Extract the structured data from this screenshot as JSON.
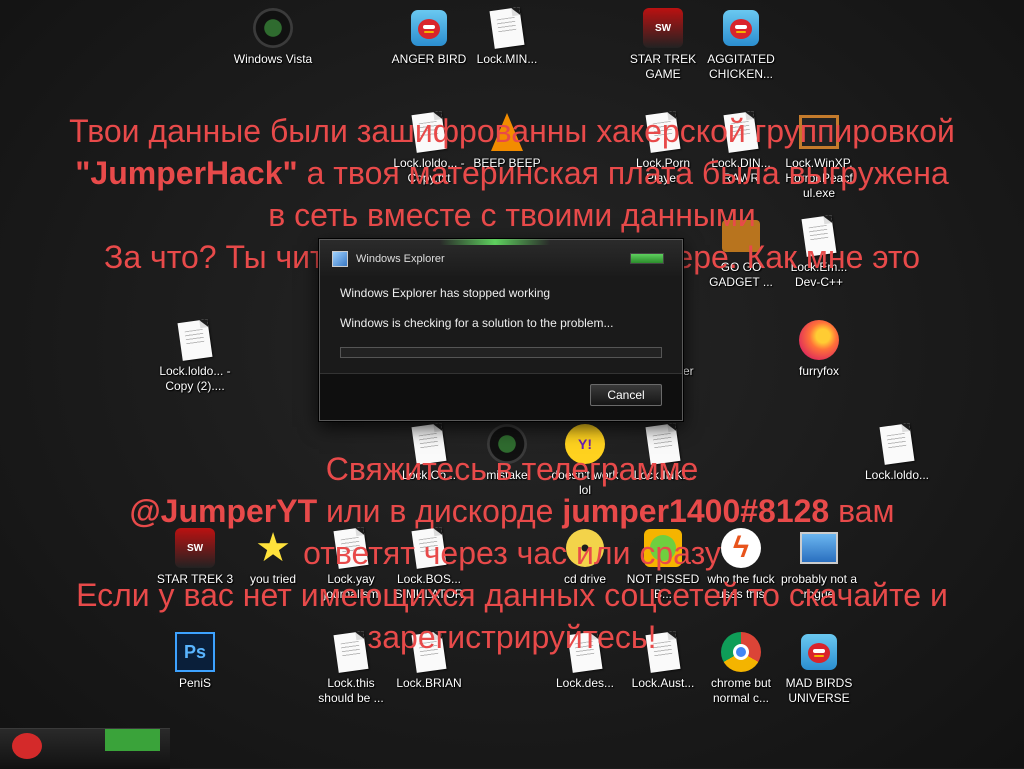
{
  "desktop": {
    "icons": [
      {
        "label": "Windows Vista",
        "icon": "round-green-icon"
      },
      {
        "label": "ANGER BIRD",
        "icon": "angry-bird-icon"
      },
      {
        "label": "Lock.MIN...",
        "icon": "document-icon"
      },
      {
        "label": "STAR TREK GAME",
        "icon": "star-wars-game-icon"
      },
      {
        "label": "AGGITATED CHICKEN...",
        "icon": "angry-bird-rio-icon"
      },
      {
        "label": "Lock.loldo... - Copy.txt",
        "icon": "document-icon"
      },
      {
        "label": "BEEP BEEP",
        "icon": "vlc-cone-icon"
      },
      {
        "label": "Lock.Porn Player",
        "icon": "document-icon"
      },
      {
        "label": "Lock.DIN... RAWR",
        "icon": "document-icon"
      },
      {
        "label": "Lock.WinXP. Horror.Peacf ul.exe",
        "icon": "tv-icon"
      },
      {
        "label": "GO GO GADGET ...",
        "icon": "briefcase-icon"
      },
      {
        "label": "Lock.Em... Dev-C++",
        "icon": "document-icon"
      },
      {
        "label": "Lock.loldo... - Copy (2)....",
        "icon": "document-icon"
      },
      {
        "label": "furryfox",
        "icon": "firefox-icon"
      },
      {
        "label": "Lock.Co...",
        "icon": "document-icon"
      },
      {
        "label": "mistake",
        "icon": "round-green-icon"
      },
      {
        "label": "doesn't work lol",
        "icon": "yahoo-icon"
      },
      {
        "label": "Lock.INK...",
        "icon": "document-icon"
      },
      {
        "label": "Lock.loldo...",
        "icon": "document-icon"
      },
      {
        "label": "STAR TREK 3",
        "icon": "star-wars-game-icon"
      },
      {
        "label": "you tried",
        "icon": "star-icon"
      },
      {
        "label": "Lock.yay journalism",
        "icon": "document-icon"
      },
      {
        "label": "Lock.BOS... SIMULATOR",
        "icon": "document-icon"
      },
      {
        "label": "cd drive",
        "icon": "cd-icon"
      },
      {
        "label": "NOT PISSED B...",
        "icon": "pig-icon"
      },
      {
        "label": "who the fuck uses this",
        "icon": "lightning-icon"
      },
      {
        "label": "probably not a rogue",
        "icon": "monitor-icon"
      },
      {
        "label": "PeniS",
        "icon": "photoshop-icon"
      },
      {
        "label": "Lock.this should be ...",
        "icon": "document-icon"
      },
      {
        "label": "Lock.BRIAN",
        "icon": "document-icon"
      },
      {
        "label": "Lock.des...",
        "icon": "document-icon"
      },
      {
        "label": "Lock.Aust...",
        "icon": "document-icon"
      },
      {
        "label": "chrome but normal c...",
        "icon": "chrome-icon"
      },
      {
        "label": "MAD BIRDS UNIVERSE",
        "icon": "angry-bird-space-icon"
      },
      {
        "label": "...ner",
        "icon": "partial-label"
      }
    ]
  },
  "ransom": {
    "line1": "Твои данные были зашифрованны хакерской группировкой",
    "line2_brand": "\"JumperHack\"",
    "line2_rest": " а твоя материнская плата была выгружена",
    "line3": "в сеть вместе с твоими данными",
    "line4": "За что? Ты читерил в игре на компьютере. Как мне это",
    "line5": "Свяжитесь в телеграмме",
    "line6_handle": "@JumperYT",
    "line6_mid": " или в дискорде ",
    "line6_discord": "jumper1400#8128",
    "line6_end": " вам",
    "line7": "ответят через час или сразу",
    "line8": "Если у вас нет имеющихся данных соцсетей то скачайте и",
    "line9": "зарегистрируйтесь!"
  },
  "dialog": {
    "title": "Windows Explorer",
    "message": "Windows Explorer has stopped working",
    "status": "Windows is checking for a solution to the problem...",
    "progress": 0,
    "cancel_label": "Cancel"
  },
  "colors": {
    "ransom_text": "#e84a4a",
    "accent_green": "#5ed05e",
    "background": "#1c1c1c"
  }
}
